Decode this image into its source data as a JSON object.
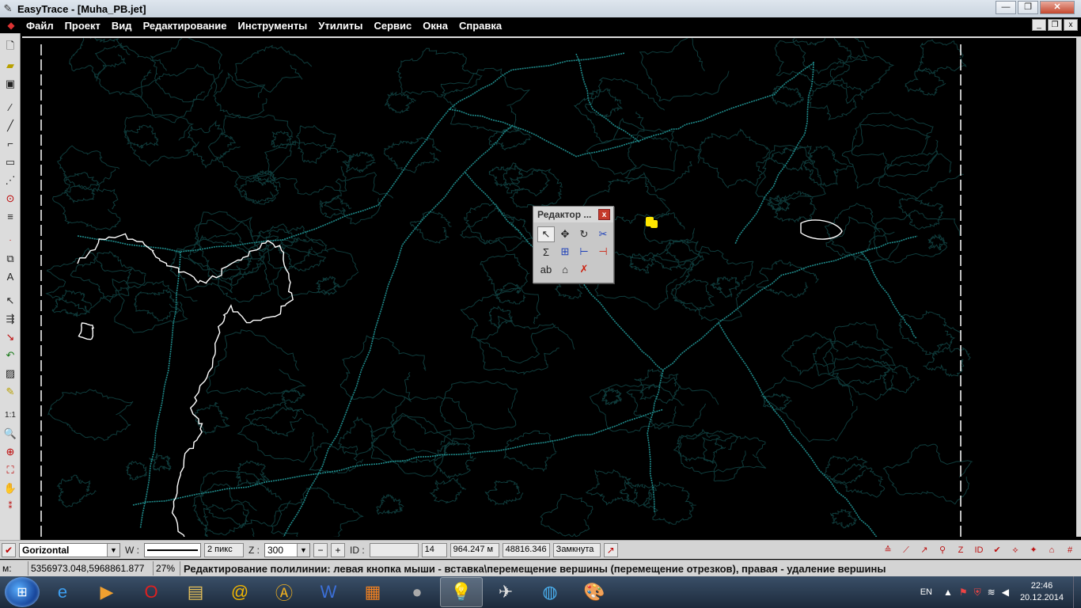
{
  "window": {
    "title": "EasyTrace - [Muha_PB.jet]",
    "controls": {
      "minimize": "—",
      "maximize": "❐",
      "close": "✕"
    }
  },
  "menu": {
    "items": [
      "Файл",
      "Проект",
      "Вид",
      "Редактирование",
      "Инструменты",
      "Утилиты",
      "Сервис",
      "Окна",
      "Справка"
    ],
    "mdi_controls": {
      "minimize": "_",
      "restore": "❐",
      "close": "x"
    }
  },
  "editor_dialog": {
    "title": "Редактор ...",
    "close": "x"
  },
  "statusbar": {
    "layer": "Gorizontal",
    "width_label": "W :",
    "width_value": "2 пикс",
    "z_label": "Z :",
    "z_value": "300",
    "minus": "−",
    "plus": "+",
    "id_label": "ID :",
    "id_value": "",
    "count": "14",
    "length": "964.247 м",
    "area": "48816.346",
    "closed": "Замкнута"
  },
  "statusbar2": {
    "mode": "м:",
    "coordinates": "5356973.048,5968861.877",
    "zoom": "27%",
    "message": "Редактирование полилинии: левая кнопка мыши - вставка\\перемещение вершины (перемещение отрезков), правая - удаление вершины"
  },
  "tray": {
    "lang": "EN",
    "time": "22:46",
    "date": "20.12.2014"
  },
  "colors": {
    "canvas": "#000000",
    "road_lines": "#1f8a8a",
    "contours": "#0f3b3b",
    "selected_polyline": "#ffffff",
    "marker": "#ffe600"
  }
}
